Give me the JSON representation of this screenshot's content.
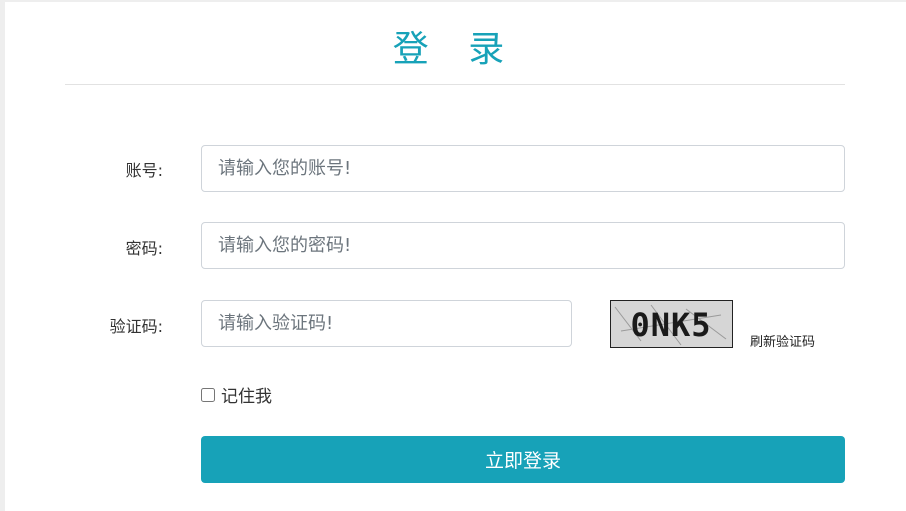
{
  "title": "登 录",
  "account": {
    "label": "账号:",
    "placeholder": "请输入您的账号!"
  },
  "password": {
    "label": "密码:",
    "placeholder": "请输入您的密码!"
  },
  "captcha": {
    "label": "验证码:",
    "placeholder": "请输入验证码!",
    "image_text": "0NK5",
    "refresh_label": "刷新验证码"
  },
  "remember": {
    "label": "记住我"
  },
  "submit_label": "立即登录",
  "colors": {
    "accent": "#17a2b8",
    "background": "#eeeeee"
  }
}
